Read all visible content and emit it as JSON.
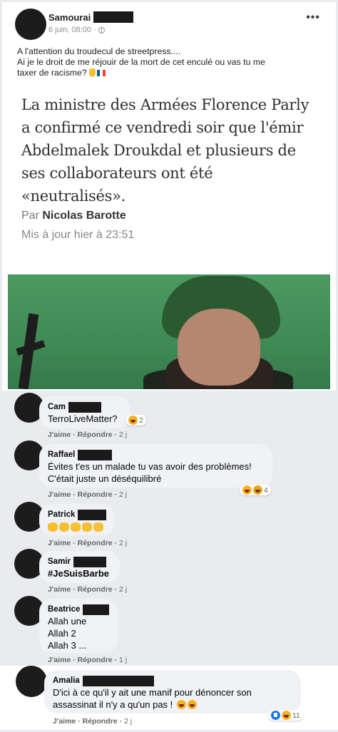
{
  "post": {
    "author": "Samourai",
    "date": "6 juin, 08:00 ·",
    "more": "•••",
    "text_line1": "A l'attention du troudecul de streetpress....",
    "text_line2": "Ai je le droit de me réjouir de la mort de cet enculé ou vas tu me",
    "text_line3": "taxer de racisme?",
    "article": {
      "body": "La ministre des Armées Florence Parly a confirmé ce vendredi soir que l'émir Abdelmalek Droukdal et plusieurs de ses collaborateurs ont été «neutralisés».",
      "byline_prefix": "Par ",
      "byline_author": "Nicolas Barotte",
      "updated": "Mis à jour hier à 23:51"
    }
  },
  "actions": {
    "like": "J'aime",
    "reply": "Répondre"
  },
  "comments": [
    {
      "name": "Cam",
      "text": "TerroLiveMatter?",
      "age": "2 j",
      "reactions": "2"
    },
    {
      "name": "Raffael",
      "line1": "Évites t'es un malade tu vas avoir des problèmes!",
      "line2": "C'était juste un déséquilibré",
      "age": "2 j",
      "reactions": "4"
    },
    {
      "name": "Patrick",
      "age": "2 j"
    },
    {
      "name": "Samir",
      "text": "#JeSuisBarbe",
      "age": "2 j"
    },
    {
      "name": "Beatrice",
      "line1": "Allah une",
      "line2": "Allah 2",
      "line3": "Allah 3 ...",
      "age": "1 j"
    },
    {
      "name": "Amalia",
      "line1": "D'ici à ce qu'il y ait une manif pour dénoncer son",
      "line2": "assassinat il n'y a qu'un pas !",
      "age": "2 j",
      "reactions": "11"
    }
  ],
  "colors": {
    "bubble": "#f0f2f5",
    "page_bg": "#e9ebee",
    "redaction": "#1a1a1a",
    "photo_green": "#4c9a62"
  }
}
